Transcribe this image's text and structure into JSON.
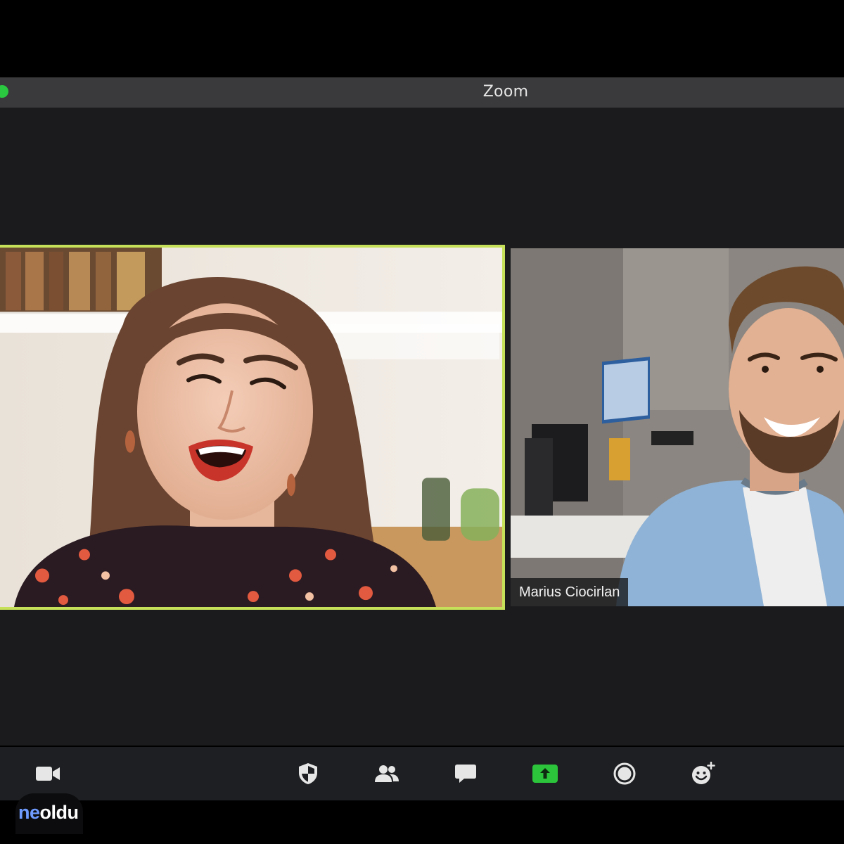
{
  "window": {
    "title": "Zoom"
  },
  "participants": [
    {
      "id": "left",
      "state": "active-speaker",
      "highlight_color": "#c6e05a"
    },
    {
      "id": "right",
      "name": "Marius Ciocirlan"
    }
  ],
  "toolbar": {
    "buttons": [
      {
        "icon": "video-camera-icon"
      },
      {
        "icon": "security-shield-icon"
      },
      {
        "icon": "participants-icon"
      },
      {
        "icon": "chat-bubble-icon"
      },
      {
        "icon": "share-screen-icon",
        "accent": "#2bc43a"
      },
      {
        "icon": "record-icon"
      },
      {
        "icon": "reactions-icon"
      }
    ]
  },
  "watermark": {
    "part1": "ne",
    "part2": "oldu"
  },
  "colors": {
    "titlebar": "#3a3a3c",
    "stage": "#1b1b1e",
    "toolbar": "#1e1f22",
    "traffic_green": "#2ac840"
  }
}
